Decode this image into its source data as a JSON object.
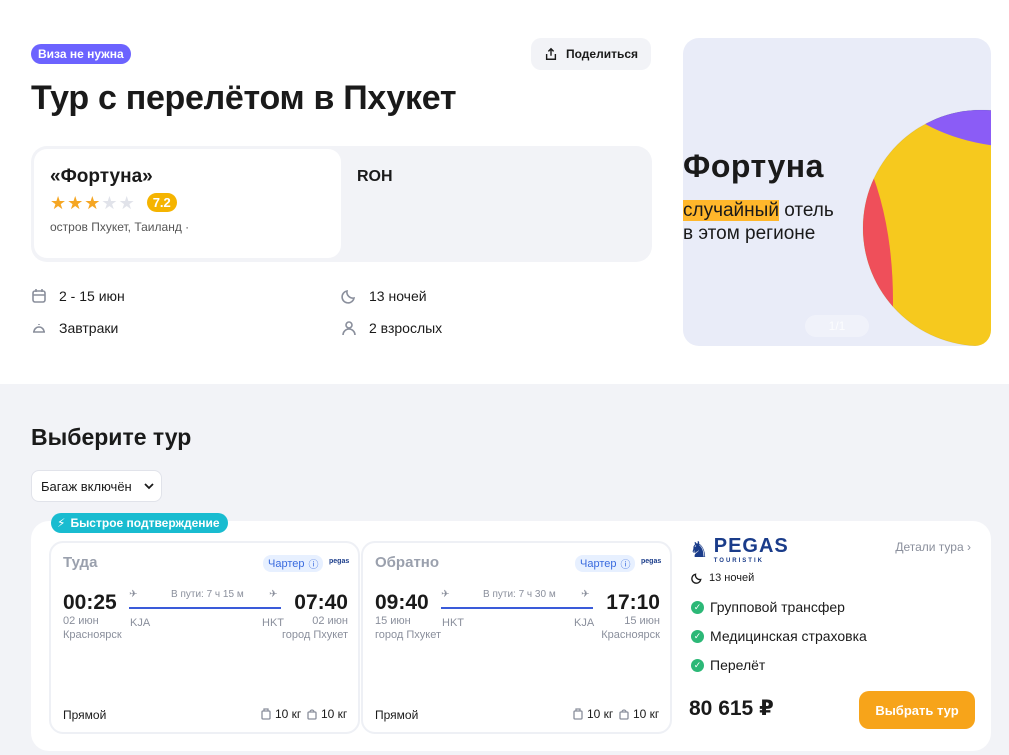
{
  "header": {
    "visa_badge": "Виза не нужна",
    "share_label": "Поделиться",
    "title": "Тур с перелётом в Пхукет"
  },
  "hotel": {
    "name": "«Фортуна»",
    "stars": 3,
    "stars_max": 5,
    "score": "7.2",
    "location": "остров Пхукет, Таиланд ·",
    "meal_code": "ROH"
  },
  "info": {
    "dates": "2 - 15 июн",
    "nights": "13 ночей",
    "meal": "Завтраки",
    "guests": "2 взрослых"
  },
  "promo": {
    "title": "Фортуна",
    "line1_highlight": "случайный",
    "line1_rest": " отель",
    "line2": "в этом регионе",
    "counter": "1/1"
  },
  "section": {
    "title": "Выберите тур",
    "filter_label": "Багаж включён"
  },
  "tour": {
    "fast_badge": "Быстрое подтверждение",
    "outbound": {
      "heading": "Туда",
      "charter": "Чартер",
      "airline": "pegas",
      "dep_time": "00:25",
      "arr_time": "07:40",
      "duration": "В пути: 7 ч 15 м",
      "dep_date": "02 июн",
      "arr_date": "02 июн",
      "dep_code": "KJA",
      "arr_code": "HKT",
      "dep_city": "Красноярск",
      "arr_city": "город Пхукет",
      "type": "Прямой",
      "bag1": "10 кг",
      "bag2": "10 кг"
    },
    "return": {
      "heading": "Обратно",
      "charter": "Чартер",
      "airline": "pegas",
      "dep_time": "09:40",
      "arr_time": "17:10",
      "duration": "В пути: 7 ч 30 м",
      "dep_date": "15 июн",
      "arr_date": "15 июн",
      "dep_code": "HKT",
      "arr_code": "KJA",
      "dep_city": "город Пхукет",
      "arr_city": "Красноярск",
      "type": "Прямой",
      "bag1": "10 кг",
      "bag2": "10 кг"
    },
    "operator": {
      "name": "PEGAS",
      "sub": "TOURISTIK",
      "details": "Детали тура",
      "nights": "13 ночей",
      "features": [
        "Групповой трансфер",
        "Медицинская страховка",
        "Перелёт"
      ],
      "price": "80 615 ₽",
      "select_label": "Выбрать тур"
    }
  },
  "colors": {
    "accent_purple": "#6c63ff",
    "accent_orange": "#f7a41a",
    "fast_badge": "#19bcd0",
    "check_green": "#2cb877",
    "score_yellow": "#f5b400",
    "route_line": "#3a5bd9"
  }
}
